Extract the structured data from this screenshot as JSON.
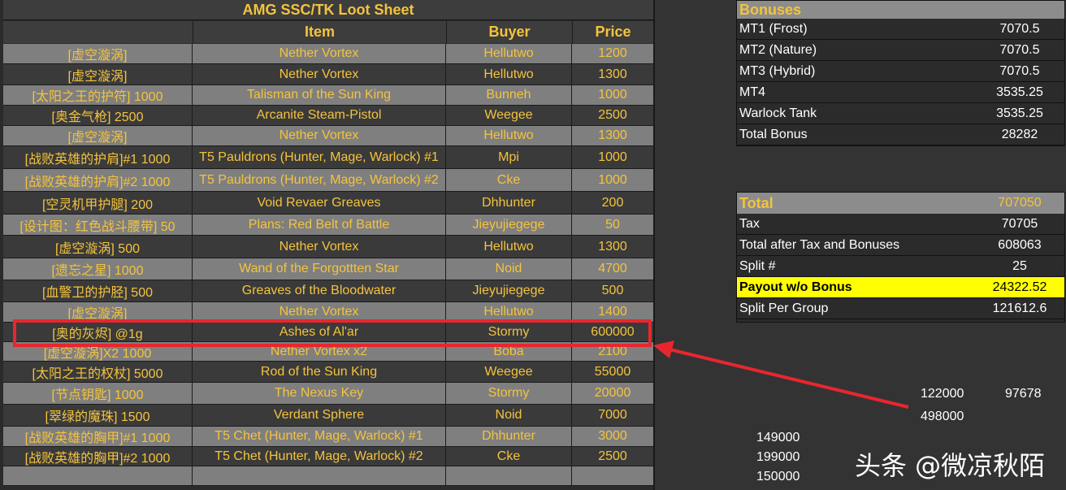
{
  "loot_sheet": {
    "title": "AMG SSC/TK Loot Sheet",
    "headers": {
      "item": "Item",
      "buyer": "Buyer",
      "price": "Price"
    },
    "rows": [
      {
        "cn": "[虚空漩涡]",
        "item": "Nether Vortex",
        "buyer": "Hellutwo",
        "price": "1200"
      },
      {
        "cn": "[虚空漩涡]",
        "item": "Nether Vortex",
        "buyer": "Hellutwo",
        "price": "1300"
      },
      {
        "cn": "[太阳之王的护符] 1000",
        "item": "Talisman of the Sun King",
        "buyer": "Bunneh",
        "price": "1000"
      },
      {
        "cn": "[奥金气枪] 2500",
        "item": "Arcanite Steam-Pistol",
        "buyer": "Weegee",
        "price": "2500"
      },
      {
        "cn": "[虚空漩涡]",
        "item": "Nether Vortex",
        "buyer": "Hellutwo",
        "price": "1300"
      },
      {
        "cn": "[战败英雄的护肩]#1 1000",
        "item": "T5 Pauldrons (Hunter, Mage, Warlock) #1",
        "buyer": "Mpi",
        "price": "1000"
      },
      {
        "cn": "[战败英雄的护肩]#2 1000",
        "item": "T5 Pauldrons (Hunter, Mage, Warlock) #2",
        "buyer": "Cke",
        "price": "1000"
      },
      {
        "cn": "[空灵机甲护腿] 200",
        "item": "Void Revaer Greaves",
        "buyer": "Dhhunter",
        "price": "200"
      },
      {
        "cn": "[设计图：红色战斗腰带] 50",
        "item": "Plans: Red Belt of Battle",
        "buyer": "Jieyujiegege",
        "price": "50"
      },
      {
        "cn": "[虚空漩涡] 500",
        "item": "Nether Vortex",
        "buyer": "Hellutwo",
        "price": "1300"
      },
      {
        "cn": "[遗忘之星] 1000",
        "item": "Wand of the Forgottten Star",
        "buyer": "Noid",
        "price": "4700"
      },
      {
        "cn": "[血警卫的护胫] 500",
        "item": "Greaves of the Bloodwater",
        "buyer": "Jieyujiegege",
        "price": "500"
      },
      {
        "cn": "[虚空漩涡]",
        "item": "Nether Vortex",
        "buyer": "Hellutwo",
        "price": "1400"
      },
      {
        "cn": "[奥的灰烬] @1g",
        "item": "Ashes of Al'ar",
        "buyer": "Stormy",
        "price": "600000"
      },
      {
        "cn": "[虚空漩涡]X2 1000",
        "item": "Nether Vortex x2",
        "buyer": "Boba",
        "price": "2100"
      },
      {
        "cn": "[太阳之王的权杖] 5000",
        "item": "Rod of the Sun King",
        "buyer": "Weegee",
        "price": "55000"
      },
      {
        "cn": "[节点钥匙] 1000",
        "item": "The Nexus Key",
        "buyer": "Stormy",
        "price": "20000"
      },
      {
        "cn": "[翠绿的魔珠] 1500",
        "item": "Verdant Sphere",
        "buyer": "Noid",
        "price": "7000"
      },
      {
        "cn": "[战败英雄的胸甲]#1 1000",
        "item": "T5 Chet (Hunter, Mage, Warlock) #1",
        "buyer": "Dhhunter",
        "price": "3000"
      },
      {
        "cn": "[战败英雄的胸甲]#2 1000",
        "item": "T5 Chet (Hunter, Mage, Warlock) #2",
        "buyer": "Cke",
        "price": "2500"
      },
      {
        "cn": "",
        "item": "",
        "buyer": "",
        "price": ""
      }
    ]
  },
  "bonuses": {
    "title": "Bonuses",
    "rows": [
      {
        "label": "MT1 (Frost)",
        "value": "7070.5"
      },
      {
        "label": "MT2 (Nature)",
        "value": "7070.5"
      },
      {
        "label": "MT3 (Hybrid)",
        "value": "7070.5"
      },
      {
        "label": "MT4",
        "value": "3535.25"
      },
      {
        "label": "Warlock Tank",
        "value": "3535.25"
      },
      {
        "label": "Total Bonus",
        "value": "28282"
      }
    ]
  },
  "totals": {
    "title": "Total",
    "title_value": "707050",
    "rows": [
      {
        "label": "Tax",
        "value": "70705"
      },
      {
        "label": "Total after Tax and Bonuses",
        "value": "608063"
      },
      {
        "label": "Split #",
        "value": "25"
      },
      {
        "label": "Payout w/o Bonus",
        "value": "24322.52"
      },
      {
        "label": "Split Per Group",
        "value": "121612.6"
      }
    ]
  },
  "loose_numbers": {
    "n1": "122000",
    "n2": "97678",
    "n3": "498000",
    "n4": "149000",
    "n5": "199000",
    "n6": "150000"
  },
  "watermark": "头条 @微凉秋陌",
  "colors": {
    "highlight": "#e8262e",
    "gold_text": "#f4c33d",
    "yellow_cell": "#ffff00"
  }
}
